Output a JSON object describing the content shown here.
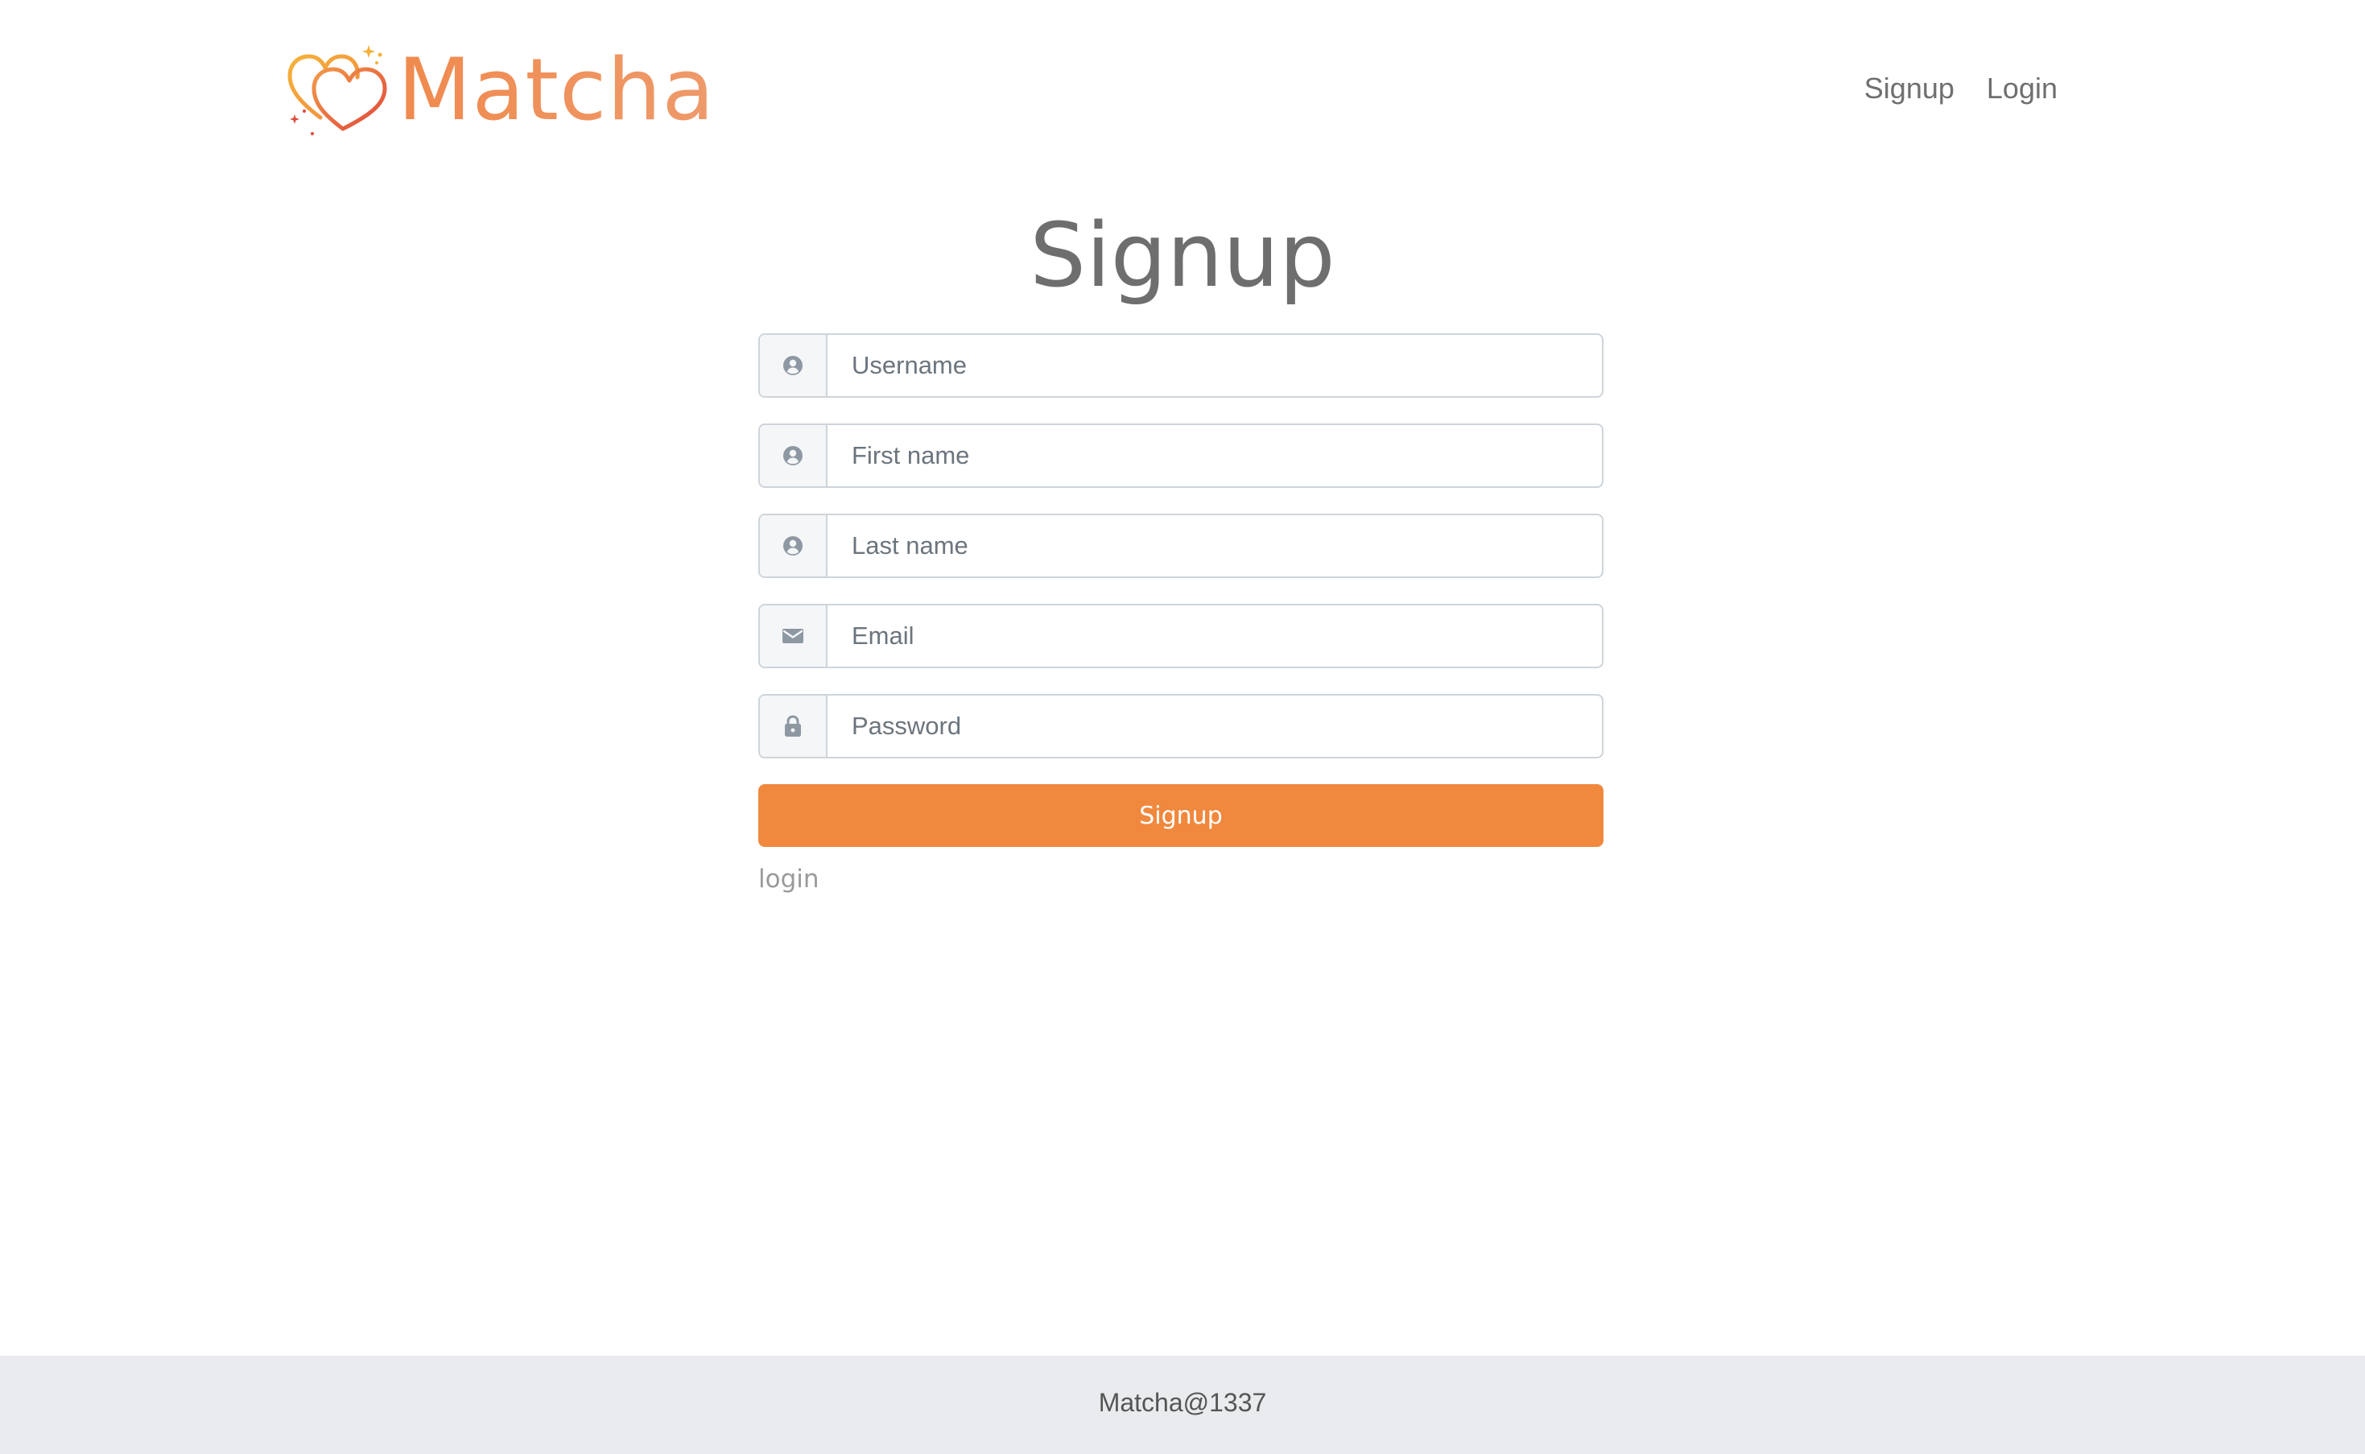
{
  "header": {
    "logo_text": "Matcha",
    "nav": {
      "signup_label": "Signup",
      "login_label": "Login"
    }
  },
  "main": {
    "title": "Signup",
    "fields": {
      "username": {
        "placeholder": "Username",
        "value": "",
        "icon": "user-icon"
      },
      "first_name": {
        "placeholder": "First name",
        "value": "",
        "icon": "user-icon"
      },
      "last_name": {
        "placeholder": "Last name",
        "value": "",
        "icon": "user-icon"
      },
      "email": {
        "placeholder": "Email",
        "value": "",
        "icon": "envelope-icon"
      },
      "password": {
        "placeholder": "Password",
        "value": "",
        "icon": "lock-icon"
      }
    },
    "submit_label": "Signup",
    "login_link_label": "login"
  },
  "footer": {
    "text": "Matcha@1337"
  },
  "colors": {
    "brand": "#ee9264",
    "button": "#f0883e",
    "footer_bg": "#e9ebee",
    "icon": "#8e98a3"
  }
}
